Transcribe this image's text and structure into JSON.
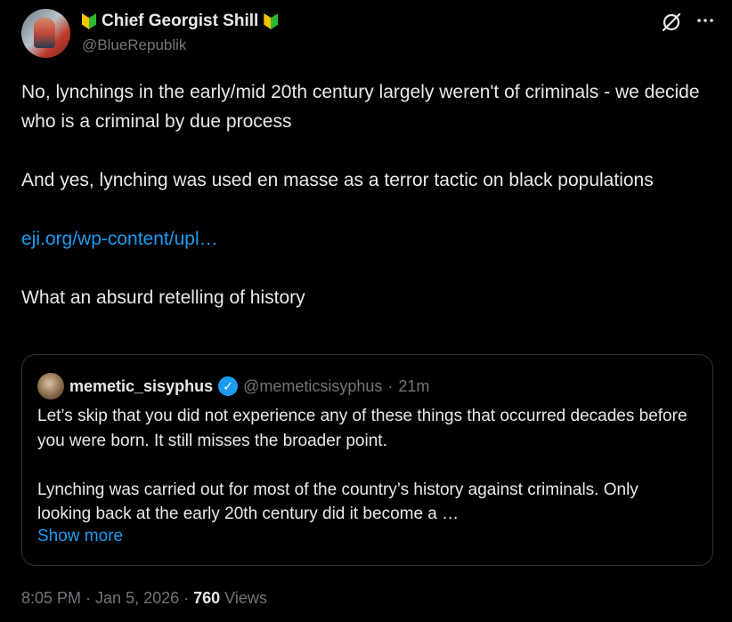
{
  "author": {
    "display_name": "Chief Georgist Shill",
    "handle": "@BlueRepublik",
    "avatar_icon": "user-avatar"
  },
  "tweet": {
    "paragraph1": "No, lynchings in the early/mid 20th century largely weren't of criminals - we decide who is a criminal by due process",
    "paragraph2": "And yes, lynching was used en masse as a terror tactic on black populations",
    "link": "eji.org/wp-content/upl…",
    "paragraph3": "What an absurd retelling of history"
  },
  "quote": {
    "name": "memetic_sisyphus",
    "handle": "@memeticsisyphus",
    "separator": "·",
    "time": "21m",
    "paragraph1": "Let’s skip that you did not experience any of these things that occurred decades before you were born. It still misses the broader point.",
    "paragraph2": "Lynching was carried out for most of the country’s history against criminals. Only looking back at the early 20th century did it become a …",
    "show_more": "Show more"
  },
  "meta": {
    "time": "8:05 PM",
    "dot1": "·",
    "date": "Jan 5, 2026",
    "dot2": "·",
    "views_count": "760",
    "views_label": "Views"
  },
  "colors": {
    "background": "#000000",
    "text": "#e7e9ea",
    "muted": "#71767b",
    "link": "#1d9bf0",
    "border": "#2f3336"
  }
}
